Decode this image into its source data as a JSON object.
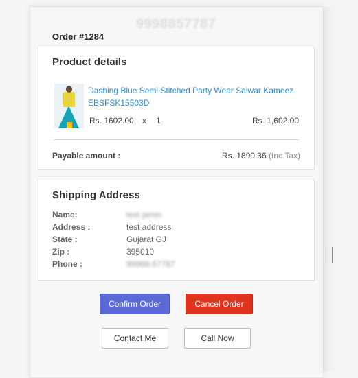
{
  "header": {
    "phone_display": "9998857787",
    "order_title": "Order #1284"
  },
  "product_section": {
    "title": "Product details",
    "items": [
      {
        "name": "Dashing Blue Semi Stitched Party Wear Salwar Kameez EBSFSK15503D",
        "unit_price": "Rs. 1602.00",
        "times": "x",
        "quantity": "1",
        "line_total": "Rs. 1,602.00"
      }
    ],
    "payable_label": "Payable amount :",
    "payable_value": "Rs. 1890.36",
    "payable_tax_note": "(Inc.Tax)"
  },
  "shipping_section": {
    "title": "Shipping Address",
    "rows": [
      {
        "label": "Name:",
        "value": "test jamin"
      },
      {
        "label": "Address :",
        "value": "test address"
      },
      {
        "label": "State :",
        "value": "Gujarat GJ"
      },
      {
        "label": "Zip :",
        "value": "395010"
      },
      {
        "label": "Phone :",
        "value": "99988-57787"
      }
    ]
  },
  "actions": {
    "confirm_label": "Confirm Order",
    "cancel_label": "Cancel Order",
    "contact_label": "Contact Me",
    "call_label": "Call Now"
  },
  "colors": {
    "confirm_bg": "#5b6ad6",
    "cancel_bg": "#e0341e",
    "link": "#2a8bd6"
  }
}
